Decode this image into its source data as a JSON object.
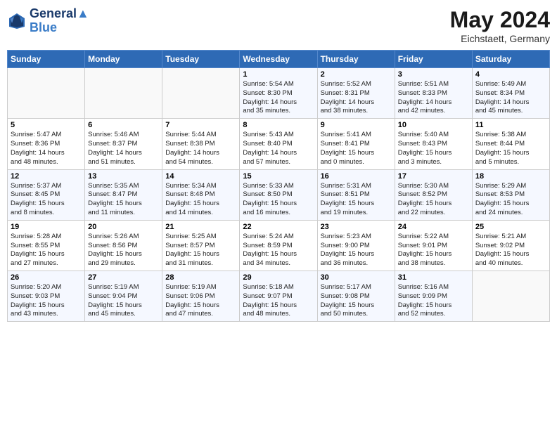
{
  "header": {
    "logo_line1": "General",
    "logo_line2": "Blue",
    "month_year": "May 2024",
    "location": "Eichstaett, Germany"
  },
  "weekdays": [
    "Sunday",
    "Monday",
    "Tuesday",
    "Wednesday",
    "Thursday",
    "Friday",
    "Saturday"
  ],
  "weeks": [
    [
      {
        "day": "",
        "info": ""
      },
      {
        "day": "",
        "info": ""
      },
      {
        "day": "",
        "info": ""
      },
      {
        "day": "1",
        "info": "Sunrise: 5:54 AM\nSunset: 8:30 PM\nDaylight: 14 hours\nand 35 minutes."
      },
      {
        "day": "2",
        "info": "Sunrise: 5:52 AM\nSunset: 8:31 PM\nDaylight: 14 hours\nand 38 minutes."
      },
      {
        "day": "3",
        "info": "Sunrise: 5:51 AM\nSunset: 8:33 PM\nDaylight: 14 hours\nand 42 minutes."
      },
      {
        "day": "4",
        "info": "Sunrise: 5:49 AM\nSunset: 8:34 PM\nDaylight: 14 hours\nand 45 minutes."
      }
    ],
    [
      {
        "day": "5",
        "info": "Sunrise: 5:47 AM\nSunset: 8:36 PM\nDaylight: 14 hours\nand 48 minutes."
      },
      {
        "day": "6",
        "info": "Sunrise: 5:46 AM\nSunset: 8:37 PM\nDaylight: 14 hours\nand 51 minutes."
      },
      {
        "day": "7",
        "info": "Sunrise: 5:44 AM\nSunset: 8:38 PM\nDaylight: 14 hours\nand 54 minutes."
      },
      {
        "day": "8",
        "info": "Sunrise: 5:43 AM\nSunset: 8:40 PM\nDaylight: 14 hours\nand 57 minutes."
      },
      {
        "day": "9",
        "info": "Sunrise: 5:41 AM\nSunset: 8:41 PM\nDaylight: 15 hours\nand 0 minutes."
      },
      {
        "day": "10",
        "info": "Sunrise: 5:40 AM\nSunset: 8:43 PM\nDaylight: 15 hours\nand 3 minutes."
      },
      {
        "day": "11",
        "info": "Sunrise: 5:38 AM\nSunset: 8:44 PM\nDaylight: 15 hours\nand 5 minutes."
      }
    ],
    [
      {
        "day": "12",
        "info": "Sunrise: 5:37 AM\nSunset: 8:45 PM\nDaylight: 15 hours\nand 8 minutes."
      },
      {
        "day": "13",
        "info": "Sunrise: 5:35 AM\nSunset: 8:47 PM\nDaylight: 15 hours\nand 11 minutes."
      },
      {
        "day": "14",
        "info": "Sunrise: 5:34 AM\nSunset: 8:48 PM\nDaylight: 15 hours\nand 14 minutes."
      },
      {
        "day": "15",
        "info": "Sunrise: 5:33 AM\nSunset: 8:50 PM\nDaylight: 15 hours\nand 16 minutes."
      },
      {
        "day": "16",
        "info": "Sunrise: 5:31 AM\nSunset: 8:51 PM\nDaylight: 15 hours\nand 19 minutes."
      },
      {
        "day": "17",
        "info": "Sunrise: 5:30 AM\nSunset: 8:52 PM\nDaylight: 15 hours\nand 22 minutes."
      },
      {
        "day": "18",
        "info": "Sunrise: 5:29 AM\nSunset: 8:53 PM\nDaylight: 15 hours\nand 24 minutes."
      }
    ],
    [
      {
        "day": "19",
        "info": "Sunrise: 5:28 AM\nSunset: 8:55 PM\nDaylight: 15 hours\nand 27 minutes."
      },
      {
        "day": "20",
        "info": "Sunrise: 5:26 AM\nSunset: 8:56 PM\nDaylight: 15 hours\nand 29 minutes."
      },
      {
        "day": "21",
        "info": "Sunrise: 5:25 AM\nSunset: 8:57 PM\nDaylight: 15 hours\nand 31 minutes."
      },
      {
        "day": "22",
        "info": "Sunrise: 5:24 AM\nSunset: 8:59 PM\nDaylight: 15 hours\nand 34 minutes."
      },
      {
        "day": "23",
        "info": "Sunrise: 5:23 AM\nSunset: 9:00 PM\nDaylight: 15 hours\nand 36 minutes."
      },
      {
        "day": "24",
        "info": "Sunrise: 5:22 AM\nSunset: 9:01 PM\nDaylight: 15 hours\nand 38 minutes."
      },
      {
        "day": "25",
        "info": "Sunrise: 5:21 AM\nSunset: 9:02 PM\nDaylight: 15 hours\nand 40 minutes."
      }
    ],
    [
      {
        "day": "26",
        "info": "Sunrise: 5:20 AM\nSunset: 9:03 PM\nDaylight: 15 hours\nand 43 minutes."
      },
      {
        "day": "27",
        "info": "Sunrise: 5:19 AM\nSunset: 9:04 PM\nDaylight: 15 hours\nand 45 minutes."
      },
      {
        "day": "28",
        "info": "Sunrise: 5:19 AM\nSunset: 9:06 PM\nDaylight: 15 hours\nand 47 minutes."
      },
      {
        "day": "29",
        "info": "Sunrise: 5:18 AM\nSunset: 9:07 PM\nDaylight: 15 hours\nand 48 minutes."
      },
      {
        "day": "30",
        "info": "Sunrise: 5:17 AM\nSunset: 9:08 PM\nDaylight: 15 hours\nand 50 minutes."
      },
      {
        "day": "31",
        "info": "Sunrise: 5:16 AM\nSunset: 9:09 PM\nDaylight: 15 hours\nand 52 minutes."
      },
      {
        "day": "",
        "info": ""
      }
    ]
  ]
}
